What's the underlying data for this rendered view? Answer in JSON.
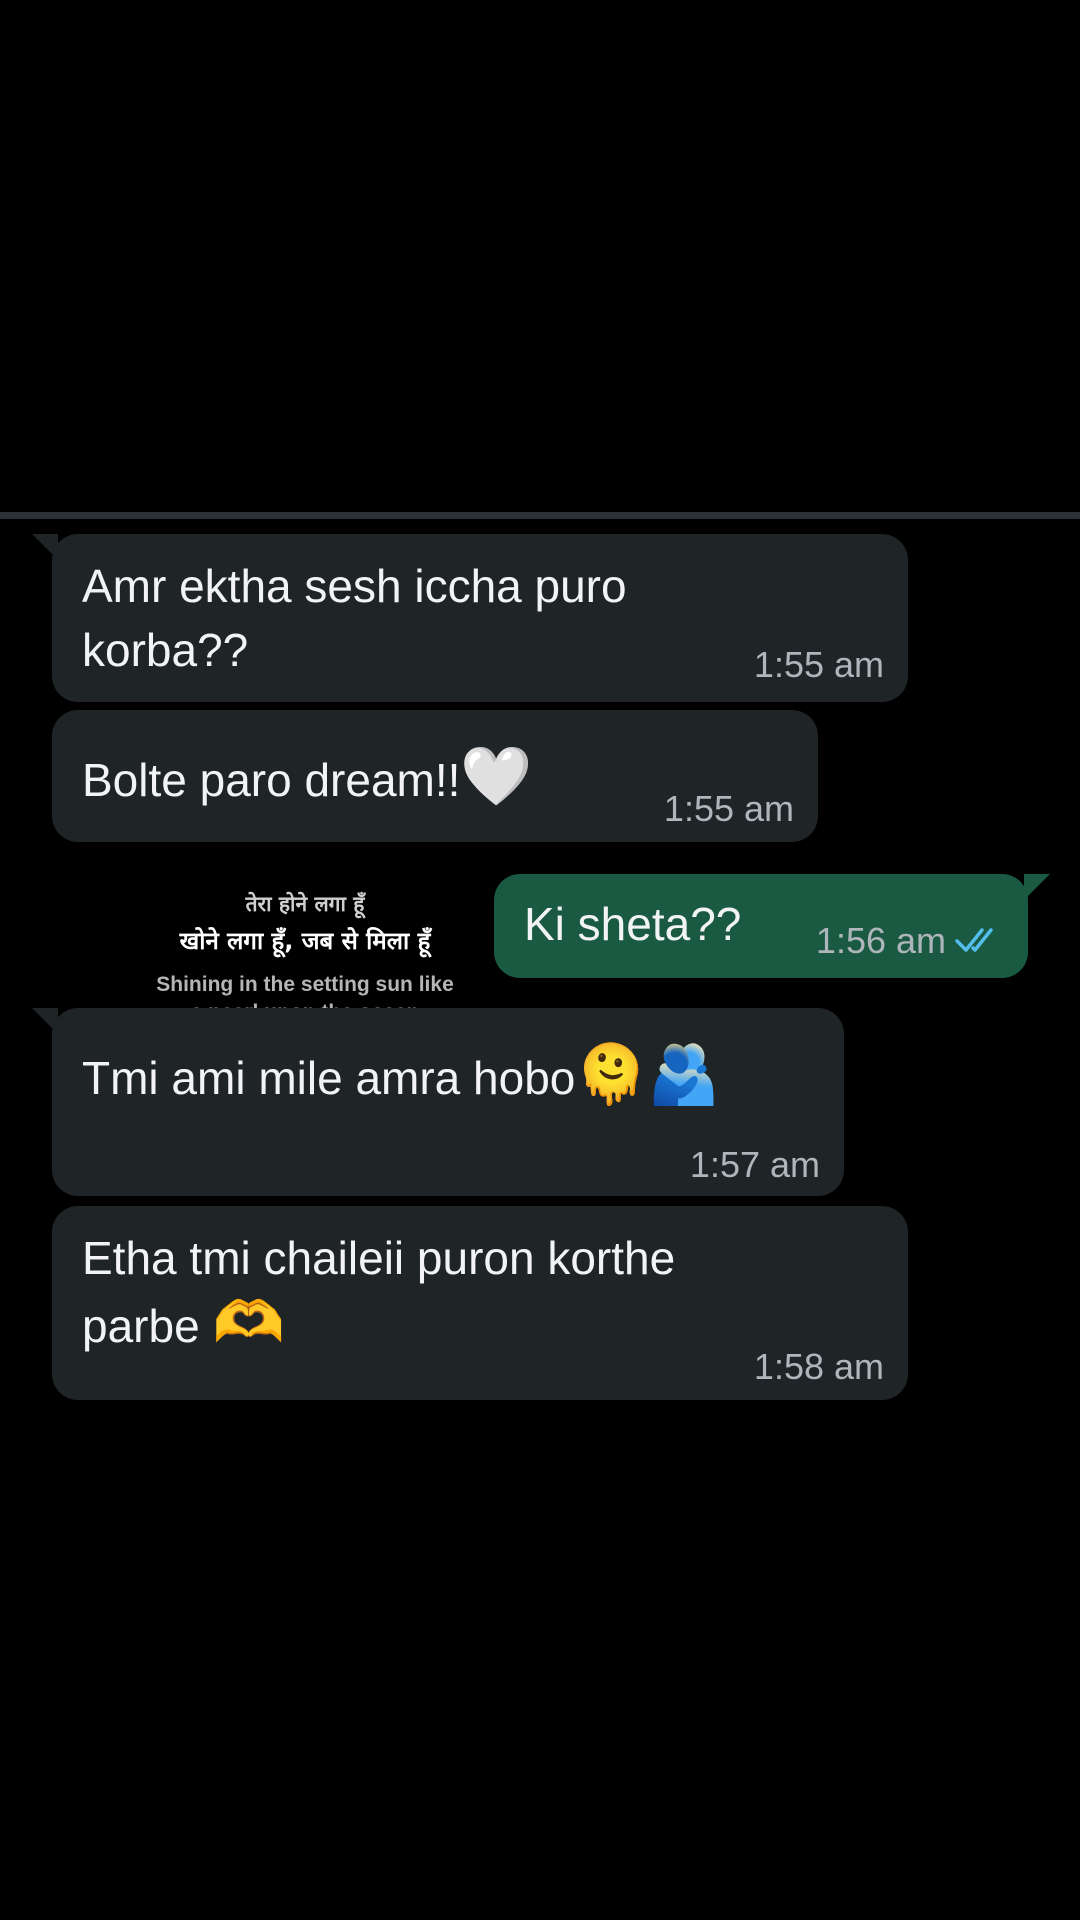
{
  "messages": [
    {
      "direction": "incoming",
      "text": "Amr ektha sesh iccha puro\nkorba??",
      "time": "1:55 am"
    },
    {
      "direction": "incoming",
      "text": "Bolte paro dream!!",
      "emoji": "🤍",
      "time": "1:55 am"
    },
    {
      "direction": "outgoing",
      "text": "Ki sheta??",
      "time": "1:56 am",
      "status": "read",
      "status_icon": "double-check-icon"
    },
    {
      "direction": "incoming",
      "text": "Tmi ami mile amra hobo",
      "emoji": "🫠🫂",
      "time": "1:57 am"
    },
    {
      "direction": "incoming",
      "text": "Etha tmi chaileii puron korthe\nparbe ",
      "emoji": "🫶",
      "time": "1:58 am"
    }
  ],
  "overlay": {
    "line1": "तेरा होने लगा हूँ",
    "line2": "खोने लगा हूँ, जब से मिला हूँ",
    "line3": "Shining in the setting sun like\na pearl upon the ocean"
  },
  "colors": {
    "background": "#000000",
    "incoming_bubble": "#1f2427",
    "outgoing_bubble": "#1a5a42",
    "read_ticks": "#53bdeb",
    "timestamp": "#aeb6bb"
  }
}
